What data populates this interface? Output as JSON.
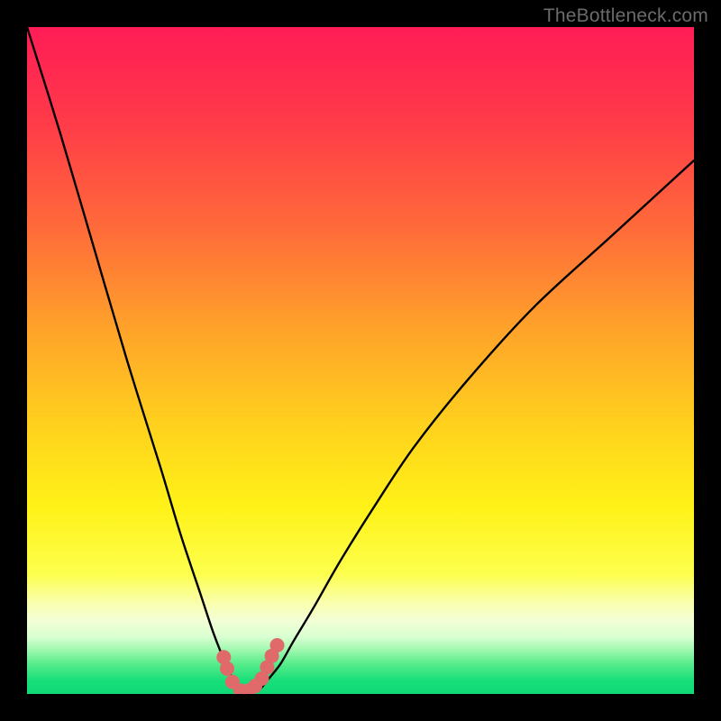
{
  "watermark": "TheBottleneck.com",
  "chart_data": {
    "type": "line",
    "title": "",
    "xlabel": "",
    "ylabel": "",
    "xlim": [
      0,
      100
    ],
    "ylim": [
      0,
      100
    ],
    "grid": false,
    "legend": false,
    "series": [
      {
        "name": "bottleneck-curve",
        "x": [
          0,
          5,
          10,
          15,
          20,
          23,
          26,
          28,
          30,
          31,
          32,
          33,
          34,
          35,
          36,
          38,
          40,
          43,
          47,
          52,
          58,
          66,
          76,
          88,
          100
        ],
        "values": [
          100,
          84,
          67,
          50,
          34,
          24,
          15,
          9,
          4,
          2,
          0.8,
          0.3,
          0.3,
          0.8,
          2,
          4.5,
          8,
          13,
          20,
          28,
          37,
          47,
          58,
          69,
          80
        ]
      }
    ],
    "markers": {
      "name": "highlight-dots",
      "color": "#e06a6a",
      "x": [
        29.5,
        30.0,
        30.8,
        32.0,
        33.2,
        34.2,
        35.2,
        36.0,
        36.7,
        37.5
      ],
      "values": [
        5.5,
        3.8,
        1.8,
        0.5,
        0.5,
        1.2,
        2.3,
        4.0,
        5.7,
        7.3
      ]
    },
    "background_gradient_stops": [
      {
        "pct": 0,
        "color": "#ff1c56"
      },
      {
        "pct": 14,
        "color": "#ff3a49"
      },
      {
        "pct": 30,
        "color": "#ff6a3a"
      },
      {
        "pct": 46,
        "color": "#ffa529"
      },
      {
        "pct": 60,
        "color": "#ffd21d"
      },
      {
        "pct": 72,
        "color": "#fff218"
      },
      {
        "pct": 82,
        "color": "#fdff4d"
      },
      {
        "pct": 86,
        "color": "#faffa7"
      },
      {
        "pct": 89,
        "color": "#f3ffd6"
      },
      {
        "pct": 91.5,
        "color": "#d8ffd0"
      },
      {
        "pct": 93.5,
        "color": "#9cf8ad"
      },
      {
        "pct": 95.5,
        "color": "#57ec8b"
      },
      {
        "pct": 98,
        "color": "#18df79"
      },
      {
        "pct": 100,
        "color": "#0fd977"
      }
    ]
  }
}
